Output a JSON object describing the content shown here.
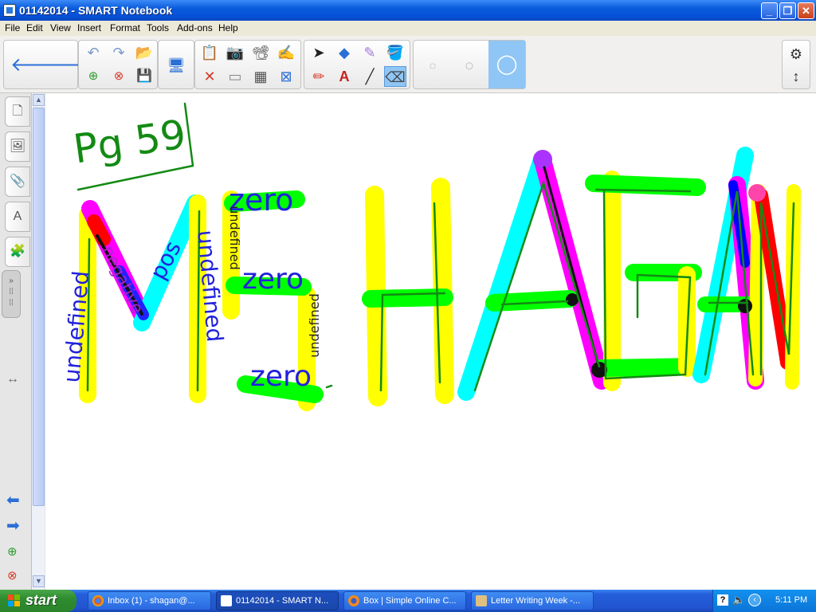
{
  "window": {
    "title": "01142014 - SMART Notebook"
  },
  "menu": [
    "File",
    "Edit",
    "View",
    "Insert",
    "Format",
    "Tools",
    "Add-ons",
    "Help"
  ],
  "handwriting": {
    "page_ref": "Pg 59",
    "name_letters": [
      "M",
      "E",
      "H",
      "A",
      "G",
      "A",
      "N"
    ],
    "slope_labels": {
      "m_left": "undefined",
      "m_neg": "negative",
      "m_pos": "pos",
      "e_left": "undefined",
      "e_zero_top": "zero",
      "e_zero_mid": "zero",
      "e_zero_bottom": "zero",
      "e_right_small": "undefined",
      "e_top_small": "undefined"
    }
  },
  "taskbar": {
    "start_label": "start",
    "tasks": [
      {
        "label": "Inbox (1) - shagan@...",
        "icon": "chrome-icon"
      },
      {
        "label": "01142014 - SMART N...",
        "icon": "smart-notebook-icon",
        "active": true
      },
      {
        "label": "Box | Simple Online C...",
        "icon": "firefox-icon"
      },
      {
        "label": "Letter Writing Week -...",
        "icon": "document-icon"
      }
    ],
    "clock": "5:11 PM"
  },
  "colors": {
    "yellow": "#ffff00",
    "cyan": "#00ffff",
    "magenta": "#ff00ff",
    "green": "#00ff00",
    "red": "#ff0000",
    "blue": "#0000ff",
    "ink_green": "#138a13",
    "ink_blue": "#2222dd"
  }
}
